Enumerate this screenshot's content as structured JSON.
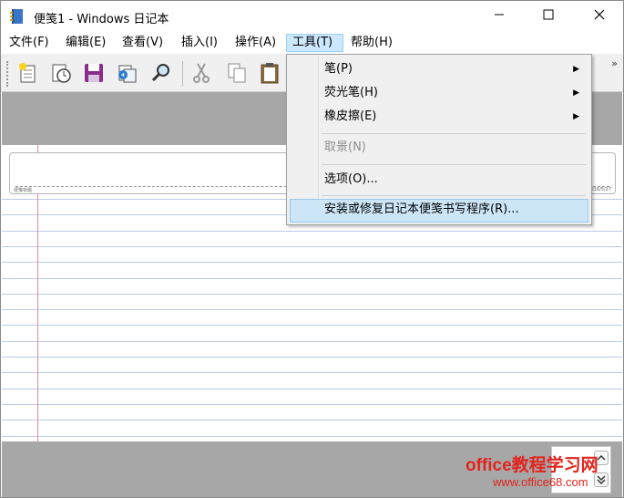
{
  "window": {
    "title": "便笺1 - Windows 日记本",
    "icons": [
      "journal-app-icon",
      "minimize-icon",
      "maximize-icon",
      "close-icon"
    ]
  },
  "menubar": [
    {
      "id": "file",
      "label": "文件(F)"
    },
    {
      "id": "edit",
      "label": "编辑(E)"
    },
    {
      "id": "view",
      "label": "查看(V)"
    },
    {
      "id": "insert",
      "label": "插入(I)"
    },
    {
      "id": "actions",
      "label": "操作(A)"
    },
    {
      "id": "tools",
      "label": "工具(T)",
      "active": true
    },
    {
      "id": "help",
      "label": "帮助(H)"
    }
  ],
  "toolbar": {
    "buttons": [
      "new-note-icon",
      "open-history-icon",
      "save-icon",
      "import-icon",
      "find-icon",
      "cut-icon",
      "copy-icon",
      "paste-icon"
    ],
    "overflow": "»"
  },
  "tools_menu": {
    "items": [
      {
        "label": "笔(P)",
        "submenu": true,
        "enabled": true
      },
      {
        "label": "荧光笔(H)",
        "submenu": true,
        "enabled": true
      },
      {
        "label": "橡皮擦(E)",
        "submenu": true,
        "enabled": true
      },
      {
        "separator": true
      },
      {
        "label": "取景(N)",
        "submenu": false,
        "enabled": false
      },
      {
        "separator": true
      },
      {
        "label": "选项(O)...",
        "submenu": false,
        "enabled": true
      },
      {
        "separator": true
      },
      {
        "label": "安装或修复日记本便笺书写程序(R)...",
        "submenu": false,
        "enabled": true,
        "highlighted": true
      }
    ]
  },
  "note": {
    "title_placeholder": "便笺标题",
    "date_text": "2016/5/27"
  },
  "colors": {
    "accent_menu": "#cce8ff",
    "page_gray": "#a7a7a7",
    "rule_line": "#b9cbe6",
    "margin_line": "#e08a9b"
  },
  "watermark": {
    "line1": "office教程学习网",
    "line2": "www.office68.com"
  }
}
